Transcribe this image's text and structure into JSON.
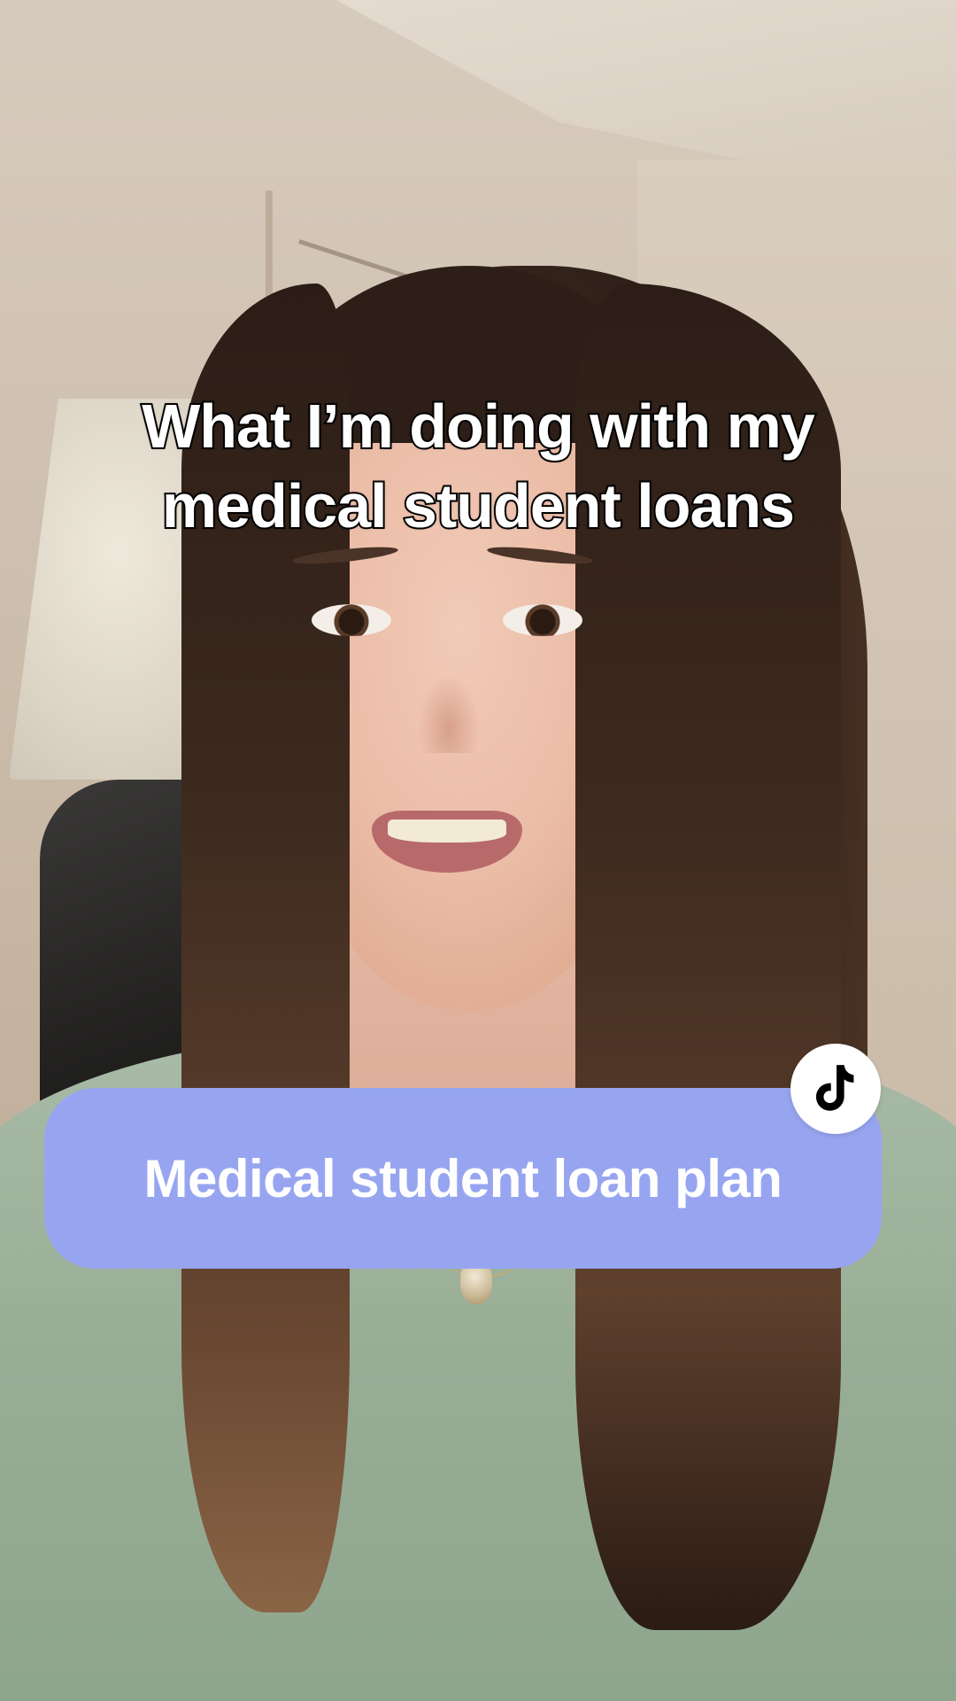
{
  "video": {
    "caption_lines": [
      "What I’m doing with my",
      "medical student loans"
    ]
  },
  "topic_pill": {
    "label": "Medical student loan plan",
    "background_color": "#97a5f1",
    "text_color": "#ffffff"
  },
  "badge": {
    "icon": "tiktok-logo-icon"
  }
}
